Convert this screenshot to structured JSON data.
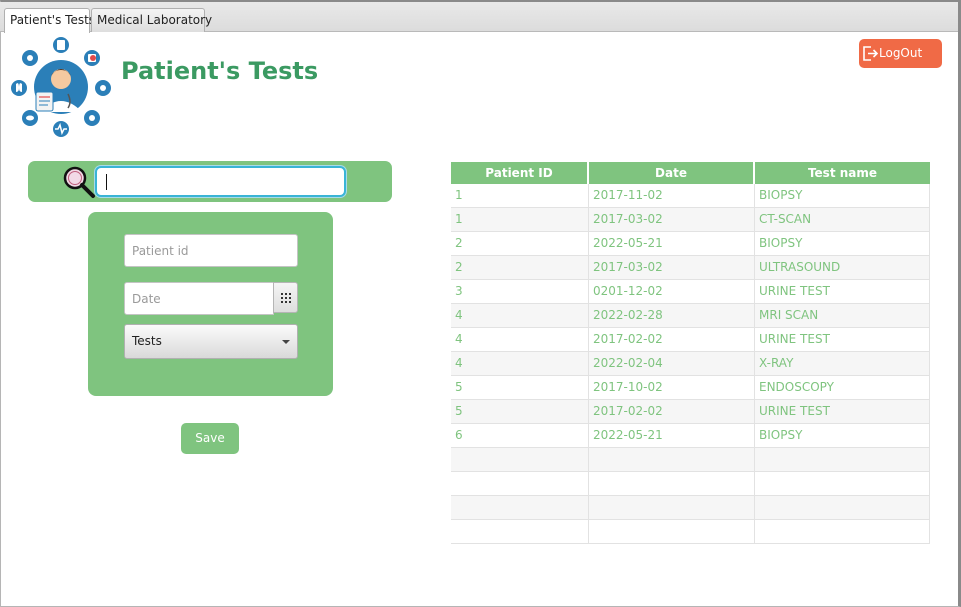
{
  "tabs": [
    {
      "label": "Patient's Tests",
      "active": true
    },
    {
      "label": "Medical Laboratory",
      "active": false
    }
  ],
  "header": {
    "title": "Patient's Tests",
    "logo_icon": "doctor-medical-icons-logo",
    "logout_label": "LogOut",
    "logout_icon": "logout-icon"
  },
  "search": {
    "icon": "magnifier-icon",
    "value": "",
    "placeholder": ""
  },
  "form": {
    "patient_id_placeholder": "Patient id",
    "date_placeholder": "Date",
    "date_icon": "calendar-icon",
    "tests_selected": "Tests",
    "save_label": "Save"
  },
  "table": {
    "columns": [
      "Patient ID",
      "Date",
      "Test name"
    ],
    "rows": [
      [
        "1",
        "2017-11-02",
        "BIOPSY"
      ],
      [
        "1",
        "2017-03-02",
        "CT-SCAN"
      ],
      [
        "2",
        "2022-05-21",
        "BIOPSY"
      ],
      [
        "2",
        "2017-03-02",
        "ULTRASOUND"
      ],
      [
        "3",
        "0201-12-02",
        "URINE TEST"
      ],
      [
        "4",
        "2022-02-28",
        "MRI SCAN"
      ],
      [
        "4",
        "2017-02-02",
        "URINE TEST"
      ],
      [
        "4",
        "2022-02-04",
        "X-RAY"
      ],
      [
        "5",
        "2017-10-02",
        "ENDOSCOPY"
      ],
      [
        "5",
        "2017-02-02",
        "URINE TEST"
      ],
      [
        "6",
        "2022-05-21",
        "BIOPSY"
      ],
      [
        "",
        "",
        ""
      ],
      [
        "",
        "",
        ""
      ],
      [
        "",
        "",
        ""
      ],
      [
        "",
        "",
        ""
      ]
    ]
  },
  "colors": {
    "accent_green": "#7fc47f",
    "title_green": "#3b9a62",
    "logout_orange": "#f06a46",
    "focus_blue": "#3ab4d6"
  }
}
